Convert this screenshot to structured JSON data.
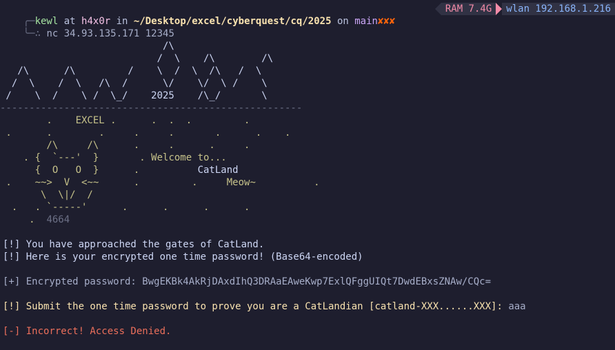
{
  "prompt": {
    "user": "kewl",
    "at": "at",
    "host": "h4x0r",
    "in": "in",
    "path": "~/Desktop/excel/cyberquest/cq/2025",
    "on": "on",
    "branch": "main",
    "git_status": "✘✘✘",
    "command": "nc 34.93.135.171 12345"
  },
  "status": {
    "ram_label": "RAM 7.4G",
    "wlan_label": "wlan 192.168.1.216"
  },
  "banner": {
    "mountains": [
      "                            /\\",
      "                           /  \\    /\\        /\\",
      "   /\\      /\\         /    \\  /  \\  /\\   /  \\",
      "  /  \\    /  \\   /\\  /      \\/    \\/  \\ /    \\",
      " /    \\  /    \\ /  \\_/    2025    /\\_/       \\"
    ],
    "year": "2025",
    "divider": "----------------------------------------------------",
    "title": "EXCEL",
    "welcome": "Welcome to...",
    "catland": "CatLand",
    "meow": "Meow~",
    "number": "4664"
  },
  "messages": {
    "line1": "[!] You have approached the gates of CatLand.",
    "line2": "[!] Here is your encrypted one time password! (Base64-encoded)",
    "enc_prefix": "[+] Encrypted password: ",
    "enc_value": "BwgEKBk4AkRjDAxdIhQ3DRAaEAweKwp7ExlQFggUIQt7DwdEBxsZNAw/CQc=",
    "submit_prompt": "[!] Submit the one time password to prove you are a CatLandian [catland-XXX......XXX]: ",
    "submit_input": "aaa",
    "error": "[-] Incorrect! Access Denied."
  }
}
